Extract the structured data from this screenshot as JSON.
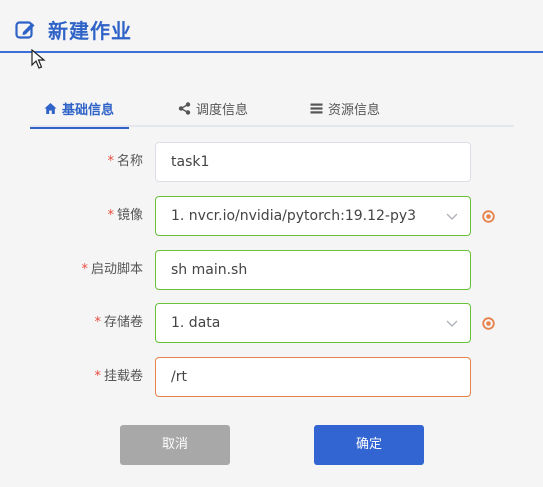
{
  "header": {
    "title": "新建作业",
    "icon": "edit-icon"
  },
  "tabs": [
    {
      "label": "基础信息",
      "icon": "home-icon",
      "active": true
    },
    {
      "label": "调度信息",
      "icon": "share-icon",
      "active": false
    },
    {
      "label": "资源信息",
      "icon": "list-icon",
      "active": false
    }
  ],
  "form": {
    "required_mark": "*",
    "name": {
      "label": "名称",
      "value": "task1"
    },
    "image": {
      "label": "镜像",
      "value": "1.  nvcr.io/nvidia/pytorch:19.12-py3"
    },
    "start_script": {
      "label": "启动脚本",
      "value": "sh main.sh"
    },
    "volume": {
      "label": "存储卷",
      "value": "1.  data"
    },
    "mount": {
      "label": "挂载卷",
      "value": "/rt"
    }
  },
  "buttons": {
    "cancel": "取消",
    "confirm": "确定"
  },
  "colors": {
    "accent": "#2f63c7",
    "valid": "#67c23a",
    "warning": "#e6824a",
    "required": "#e84b3c"
  }
}
